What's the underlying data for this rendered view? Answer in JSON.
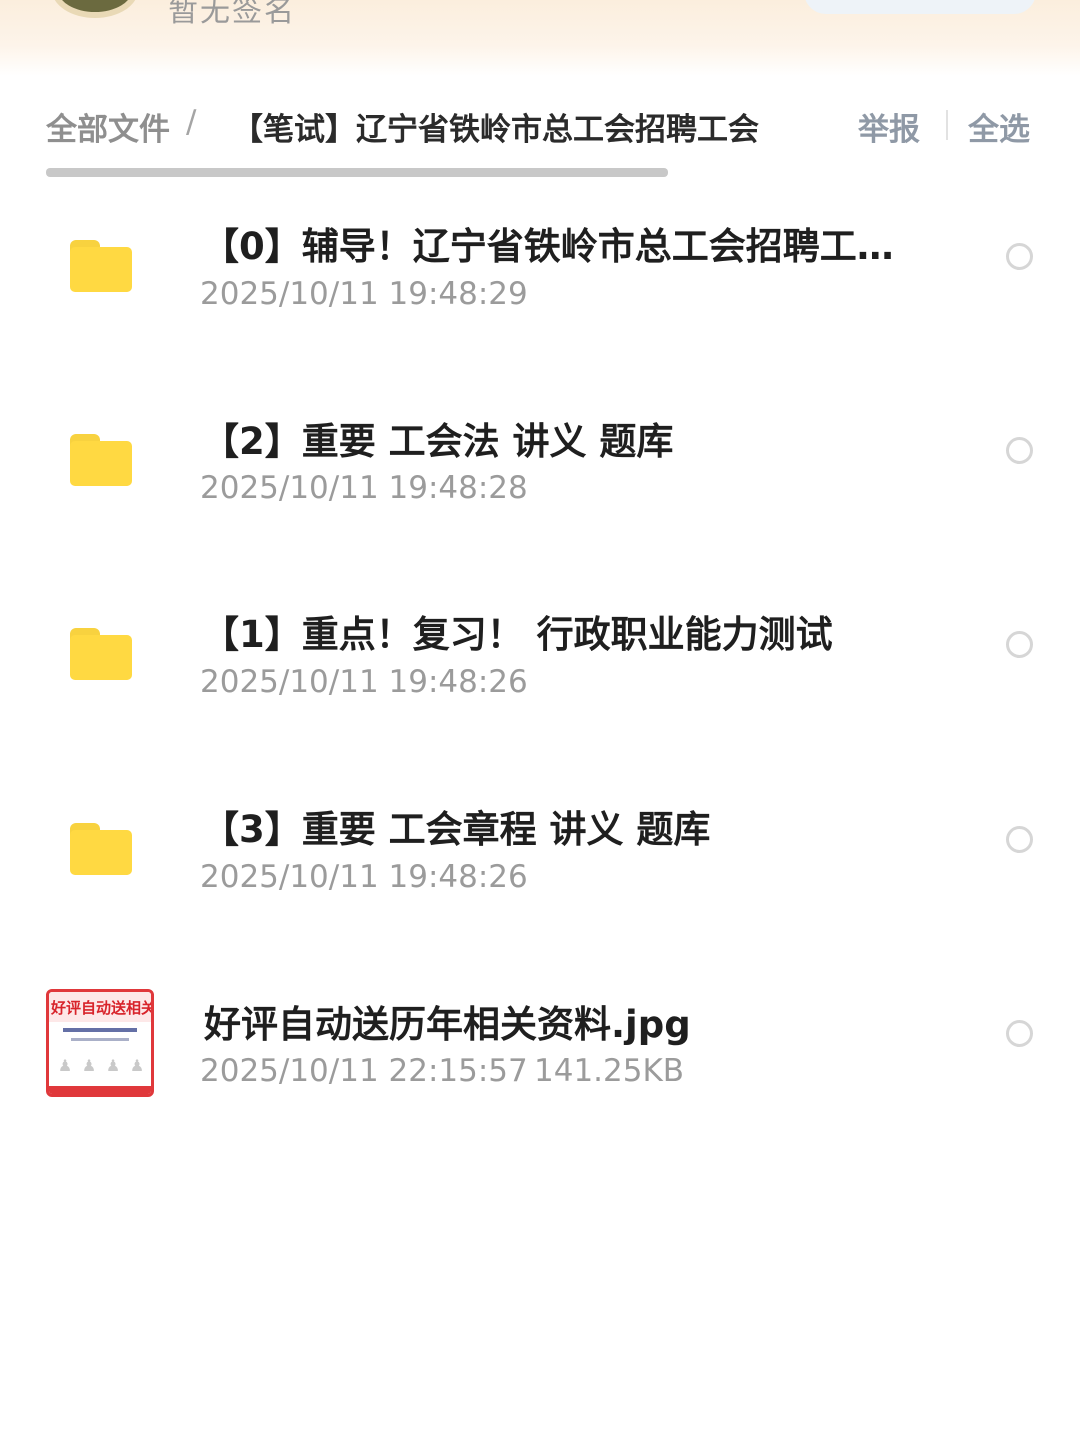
{
  "header": {
    "signature": "暂无签名"
  },
  "breadcrumb": {
    "root": "全部文件",
    "separator": "/",
    "current": "【笔试】辽宁省铁岭市总工会招聘工会"
  },
  "actions": {
    "report": "举报",
    "select_all": "全选"
  },
  "files": [
    {
      "type": "folder",
      "name": "【0】辅导！辽宁省铁岭市总工会招聘工…",
      "date": "2025/10/11 19:48:29"
    },
    {
      "type": "folder",
      "name": "【2】重要 工会法 讲义 题库",
      "date": "2025/10/11 19:48:28"
    },
    {
      "type": "folder",
      "name": "【1】重点！复习！ 行政职业能力测试",
      "date": "2025/10/11 19:48:26"
    },
    {
      "type": "folder",
      "name": "【3】重要 工会章程 讲义 题库",
      "date": "2025/10/11 19:48:26"
    },
    {
      "type": "image",
      "name": "好评自动送历年相关资料.jpg",
      "date": "2025/10/11 22:15:57",
      "size": "141.25KB",
      "thumbnail_text": "好评自动送相关"
    }
  ],
  "colors": {
    "folder": "#ffd942",
    "accent_gray": "#8f99a6",
    "thumbnail_border": "#e0383b"
  }
}
